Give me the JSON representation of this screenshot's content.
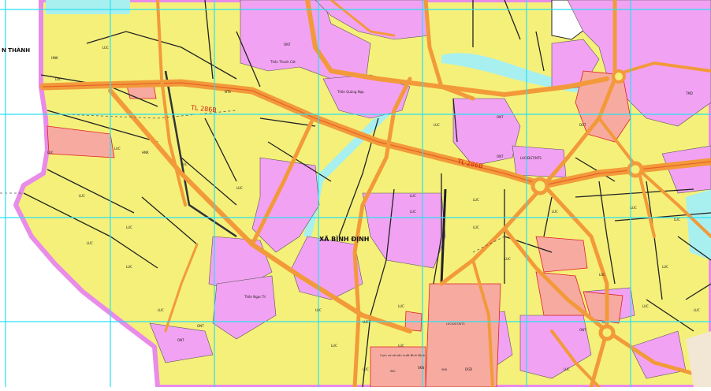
{
  "map": {
    "commune_name": "XÃ BÌNH ĐỊNH",
    "neighbor_label": "N THÀNH",
    "road_labels": [
      "TL 286B",
      "TL 286B"
    ],
    "hamlets": [
      "Thôn Thanh Cát",
      "Thôn Quảng Nạp",
      "Thôn Ngọc Trì"
    ],
    "landuse_labels": [
      "LUC",
      "ONT",
      "NTS",
      "HNK",
      "DGT",
      "SKN",
      "TMD",
      "DGD",
      "LUC/ĐGT/NTS",
      "ONT",
      "LUC",
      "LUC",
      "LUC",
      "LUC",
      "LUC",
      "LUC",
      "LUC",
      "LUC",
      "LUC",
      "ONT",
      "ONT",
      "LUC",
      "LUC",
      "HNK",
      "LUC",
      "LUC",
      "LUC",
      "LUC",
      "LUC",
      "LUC",
      "LUC",
      "LUC",
      "LUC",
      "LUC",
      "LUC",
      "LUC",
      "LUC",
      "ONT",
      "LUC",
      "ONT",
      "LUC",
      "LUC",
      "LUC",
      "LUC",
      "LUC",
      "HNK"
    ],
    "area_labels": [
      "Cụm cơ sở sản xuất Bình Định",
      "SKC",
      "LUC/DGT/NTS",
      "SKN"
    ],
    "colors": {
      "agricultural": "#f5f07a",
      "residential": "#f2a2f2",
      "industrial": "#f7aaa0",
      "water": "#a8f0ef",
      "road": "#f29a3a",
      "grid": "#29e0f2",
      "boundary": "#e98be9"
    }
  }
}
